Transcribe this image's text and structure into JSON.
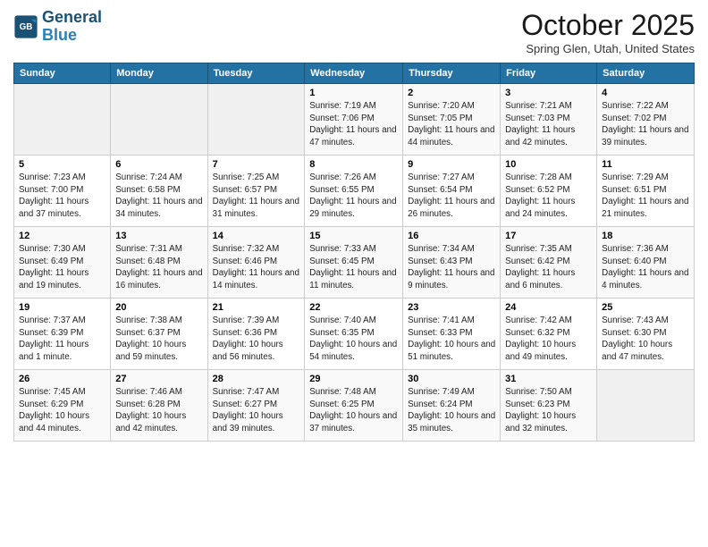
{
  "header": {
    "logo_line1": "General",
    "logo_line2": "Blue",
    "month": "October 2025",
    "location": "Spring Glen, Utah, United States"
  },
  "days_of_week": [
    "Sunday",
    "Monday",
    "Tuesday",
    "Wednesday",
    "Thursday",
    "Friday",
    "Saturday"
  ],
  "weeks": [
    [
      {
        "day": "",
        "info": ""
      },
      {
        "day": "",
        "info": ""
      },
      {
        "day": "",
        "info": ""
      },
      {
        "day": "1",
        "info": "Sunrise: 7:19 AM\nSunset: 7:06 PM\nDaylight: 11 hours and 47 minutes."
      },
      {
        "day": "2",
        "info": "Sunrise: 7:20 AM\nSunset: 7:05 PM\nDaylight: 11 hours and 44 minutes."
      },
      {
        "day": "3",
        "info": "Sunrise: 7:21 AM\nSunset: 7:03 PM\nDaylight: 11 hours and 42 minutes."
      },
      {
        "day": "4",
        "info": "Sunrise: 7:22 AM\nSunset: 7:02 PM\nDaylight: 11 hours and 39 minutes."
      }
    ],
    [
      {
        "day": "5",
        "info": "Sunrise: 7:23 AM\nSunset: 7:00 PM\nDaylight: 11 hours and 37 minutes."
      },
      {
        "day": "6",
        "info": "Sunrise: 7:24 AM\nSunset: 6:58 PM\nDaylight: 11 hours and 34 minutes."
      },
      {
        "day": "7",
        "info": "Sunrise: 7:25 AM\nSunset: 6:57 PM\nDaylight: 11 hours and 31 minutes."
      },
      {
        "day": "8",
        "info": "Sunrise: 7:26 AM\nSunset: 6:55 PM\nDaylight: 11 hours and 29 minutes."
      },
      {
        "day": "9",
        "info": "Sunrise: 7:27 AM\nSunset: 6:54 PM\nDaylight: 11 hours and 26 minutes."
      },
      {
        "day": "10",
        "info": "Sunrise: 7:28 AM\nSunset: 6:52 PM\nDaylight: 11 hours and 24 minutes."
      },
      {
        "day": "11",
        "info": "Sunrise: 7:29 AM\nSunset: 6:51 PM\nDaylight: 11 hours and 21 minutes."
      }
    ],
    [
      {
        "day": "12",
        "info": "Sunrise: 7:30 AM\nSunset: 6:49 PM\nDaylight: 11 hours and 19 minutes."
      },
      {
        "day": "13",
        "info": "Sunrise: 7:31 AM\nSunset: 6:48 PM\nDaylight: 11 hours and 16 minutes."
      },
      {
        "day": "14",
        "info": "Sunrise: 7:32 AM\nSunset: 6:46 PM\nDaylight: 11 hours and 14 minutes."
      },
      {
        "day": "15",
        "info": "Sunrise: 7:33 AM\nSunset: 6:45 PM\nDaylight: 11 hours and 11 minutes."
      },
      {
        "day": "16",
        "info": "Sunrise: 7:34 AM\nSunset: 6:43 PM\nDaylight: 11 hours and 9 minutes."
      },
      {
        "day": "17",
        "info": "Sunrise: 7:35 AM\nSunset: 6:42 PM\nDaylight: 11 hours and 6 minutes."
      },
      {
        "day": "18",
        "info": "Sunrise: 7:36 AM\nSunset: 6:40 PM\nDaylight: 11 hours and 4 minutes."
      }
    ],
    [
      {
        "day": "19",
        "info": "Sunrise: 7:37 AM\nSunset: 6:39 PM\nDaylight: 11 hours and 1 minute."
      },
      {
        "day": "20",
        "info": "Sunrise: 7:38 AM\nSunset: 6:37 PM\nDaylight: 10 hours and 59 minutes."
      },
      {
        "day": "21",
        "info": "Sunrise: 7:39 AM\nSunset: 6:36 PM\nDaylight: 10 hours and 56 minutes."
      },
      {
        "day": "22",
        "info": "Sunrise: 7:40 AM\nSunset: 6:35 PM\nDaylight: 10 hours and 54 minutes."
      },
      {
        "day": "23",
        "info": "Sunrise: 7:41 AM\nSunset: 6:33 PM\nDaylight: 10 hours and 51 minutes."
      },
      {
        "day": "24",
        "info": "Sunrise: 7:42 AM\nSunset: 6:32 PM\nDaylight: 10 hours and 49 minutes."
      },
      {
        "day": "25",
        "info": "Sunrise: 7:43 AM\nSunset: 6:30 PM\nDaylight: 10 hours and 47 minutes."
      }
    ],
    [
      {
        "day": "26",
        "info": "Sunrise: 7:45 AM\nSunset: 6:29 PM\nDaylight: 10 hours and 44 minutes."
      },
      {
        "day": "27",
        "info": "Sunrise: 7:46 AM\nSunset: 6:28 PM\nDaylight: 10 hours and 42 minutes."
      },
      {
        "day": "28",
        "info": "Sunrise: 7:47 AM\nSunset: 6:27 PM\nDaylight: 10 hours and 39 minutes."
      },
      {
        "day": "29",
        "info": "Sunrise: 7:48 AM\nSunset: 6:25 PM\nDaylight: 10 hours and 37 minutes."
      },
      {
        "day": "30",
        "info": "Sunrise: 7:49 AM\nSunset: 6:24 PM\nDaylight: 10 hours and 35 minutes."
      },
      {
        "day": "31",
        "info": "Sunrise: 7:50 AM\nSunset: 6:23 PM\nDaylight: 10 hours and 32 minutes."
      },
      {
        "day": "",
        "info": ""
      }
    ]
  ]
}
